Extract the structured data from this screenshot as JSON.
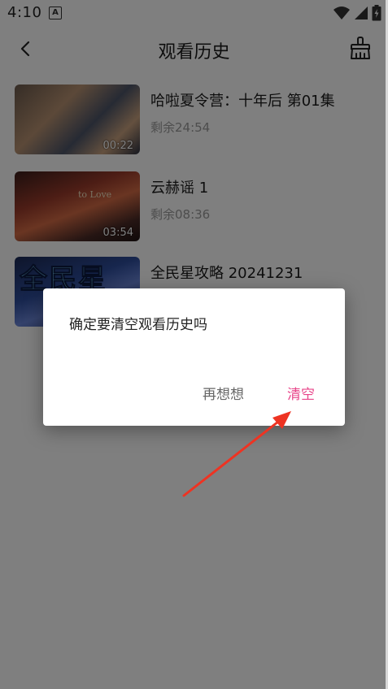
{
  "status_bar": {
    "time": "4:10",
    "notification_badge": "A"
  },
  "header": {
    "title": "观看历史"
  },
  "history": [
    {
      "title": "哈啦夏令营：十年后 第01集",
      "remaining": "剩余24:54",
      "duration": "00:22"
    },
    {
      "title": "云赫谣 1",
      "remaining": "剩余08:36",
      "duration": "03:54",
      "thumb_text": "to Love"
    },
    {
      "title": "全民星攻略 20241231",
      "remaining": "",
      "duration": "",
      "thumb_text": "全民星"
    }
  ],
  "dialog": {
    "message": "确定要清空观看历史吗",
    "cancel_label": "再想想",
    "confirm_label": "清空"
  },
  "colors": {
    "accent": "#e8468a",
    "annotation_arrow": "#ee3322"
  },
  "icons": [
    "back-arrow-icon",
    "broom-icon",
    "wifi-icon",
    "signal-icon",
    "battery-icon"
  ]
}
